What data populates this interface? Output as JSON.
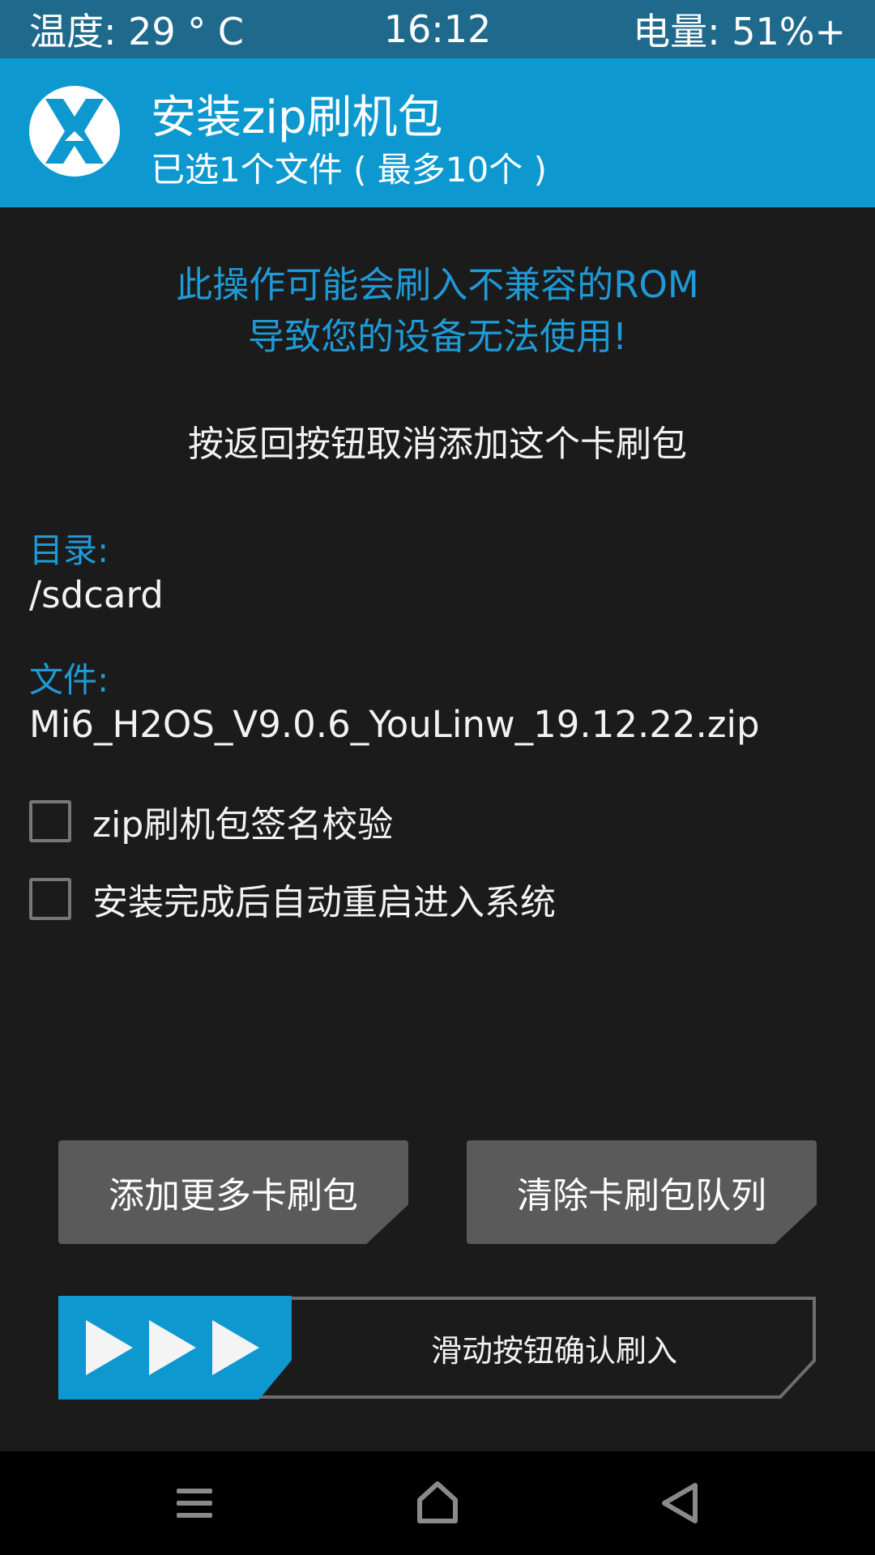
{
  "status_bar": {
    "temperature": "温度: 29 ° C",
    "time": "16:12",
    "battery": "电量: 51%+"
  },
  "header": {
    "icon": "twrp-logo",
    "title": "安装zip刷机包",
    "subtitle": "已选1个文件 ( 最多10个 )"
  },
  "warning": {
    "line1": "此操作可能会刷入不兼容的ROM",
    "line2": "导致您的设备无法使用!"
  },
  "hint": "按返回按钮取消添加这个卡刷包",
  "folder": {
    "label": "目录:",
    "value": "/sdcard"
  },
  "file": {
    "label": "文件:",
    "value": "Mi6_H2OS_V9.0.6_YouLinw_19.12.22.zip"
  },
  "options": [
    {
      "label": "zip刷机包签名校验",
      "checked": false
    },
    {
      "label": "安装完成后自动重启进入系统",
      "checked": false
    }
  ],
  "buttons": {
    "add_more": "添加更多卡刷包",
    "clear_queue": "清除卡刷包队列"
  },
  "slider": {
    "label": "滑动按钮确认刷入",
    "icon": "triple-play-arrow-icon"
  },
  "nav": {
    "menu_icon": "menu-icon",
    "home_icon": "home-icon",
    "back_icon": "back-icon"
  },
  "colors": {
    "accent": "#0d99d0",
    "status_bar": "#1f6a8c",
    "background": "#1b1b1b",
    "button": "#5a5a5a",
    "warning_text": "#1e9ad6"
  }
}
